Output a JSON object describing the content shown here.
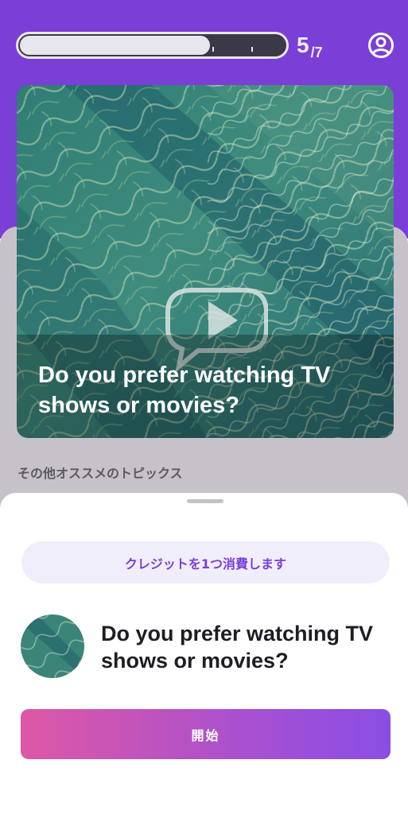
{
  "progress": {
    "current": "5",
    "total": "/7",
    "fraction": 0.71
  },
  "icons": {
    "profile": "person-circle-icon",
    "play": "video-chat-bubble-icon"
  },
  "topic_card": {
    "title": "Do you prefer watching TV shows or movies?"
  },
  "section": {
    "label": "その他オススメのトピックス"
  },
  "sheet": {
    "credit_notice": "クレジットを1つ消費します",
    "topic_title": "Do you prefer watching TV shows or movies?",
    "start_label": "開始"
  },
  "colors": {
    "accent_purple": "#7a3fd6",
    "start_gradient_start": "#de58a5",
    "start_gradient_end": "#8a4ee4",
    "credit_text": "#7b3fd8"
  }
}
